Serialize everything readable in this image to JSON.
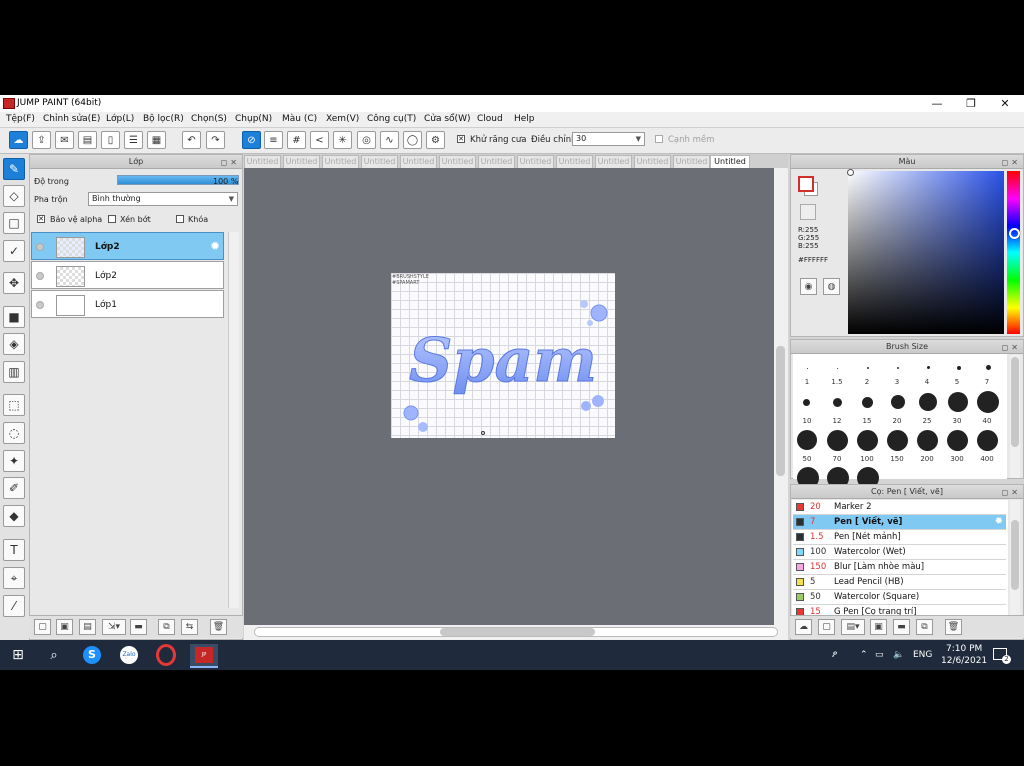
{
  "window": {
    "title": "JUMP PAINT (64bit)",
    "minimize": "—",
    "maximize": "❐",
    "close": "✕"
  },
  "menu": [
    "Tệp(F)",
    "Chỉnh sửa(E)",
    "Lớp(L)",
    "Bộ lọc(R)",
    "Chọn(S)",
    "Chụp(N)",
    "Màu (C)",
    "Xem(V)",
    "Công cụ(T)",
    "Cửa sổ(W)",
    "Cloud",
    "Help"
  ],
  "toolbar": {
    "antialias_label": "Khử răng cưa",
    "adjust_label": "Điều chỉnh",
    "adjust_value": "30",
    "smooth_label": "Cạnh mềm"
  },
  "layer_panel": {
    "title": "Lớp",
    "opacity_label": "Độ trong",
    "opacity_value": "100 %",
    "opacity_fraction": 1.0,
    "blend_label": "Pha trộn",
    "blend_value": "Bình thường",
    "protect_alpha": "Bảo vệ alpha",
    "clipping": "Xén bớt",
    "lock": "Khóa",
    "layers": [
      {
        "name": "Lớp2",
        "selected": true
      },
      {
        "name": "Lớp2",
        "selected": false
      },
      {
        "name": "Lớp1",
        "selected": false
      }
    ]
  },
  "tabs": [
    "Untitled",
    "Untitled",
    "Untitled",
    "Untitled",
    "Untitled",
    "Untitled",
    "Untitled",
    "Untitled",
    "Untitled",
    "Untitled",
    "Untitled",
    "Untitled",
    "Untitled"
  ],
  "canvas": {
    "artwork_text": "Spam",
    "corner_note": "#BRUSHSTYLE #SPAMART"
  },
  "color_panel": {
    "title": "Màu",
    "r": "R:255",
    "g": "G:255",
    "b": "B:255",
    "hex": "#FFFFFF"
  },
  "brush_size_panel": {
    "title": "Brush Size",
    "sizes": [
      "1",
      "1.5",
      "2",
      "3",
      "4",
      "5",
      "7",
      "10",
      "12",
      "15",
      "20",
      "25",
      "30",
      "40",
      "50",
      "70",
      "100",
      "150",
      "200",
      "300",
      "400"
    ]
  },
  "brush_panel": {
    "title": "Cọ: Pen [ Viết, vẽ]",
    "brushes": [
      {
        "size": "20",
        "name": "Marker 2",
        "color": "#e53935"
      },
      {
        "size": "7",
        "name": "Pen [ Viết, vẽ]",
        "color": "#263238",
        "selected": true
      },
      {
        "size": "1.5",
        "name": "Pen [Nét mảnh]",
        "color": "#263238"
      },
      {
        "size": "100",
        "name": "Watercolor (Wet)",
        "color": "#80d8ff"
      },
      {
        "size": "150",
        "name": "Blur [Làm nhòe màu]",
        "color": "#f8a5e8"
      },
      {
        "size": "5",
        "name": "Lead Pencil (HB)",
        "color": "#f4e04d"
      },
      {
        "size": "50",
        "name": "Watercolor (Square)",
        "color": "#9ccc65"
      },
      {
        "size": "15",
        "name": "G Pen [Cọ trang trí]",
        "color": "#e53935"
      }
    ]
  },
  "taskbar": {
    "time": "7:10 PM",
    "date": "12/6/2021",
    "lang": "ENG",
    "notif_count": "2"
  }
}
